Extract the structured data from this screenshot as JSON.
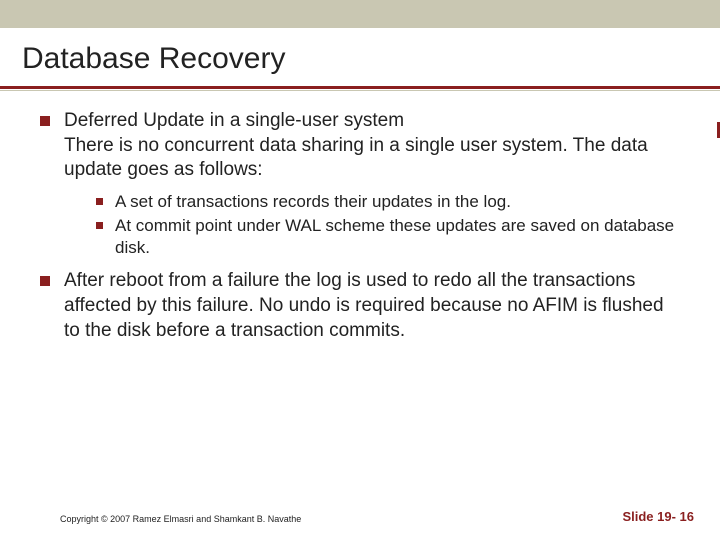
{
  "slide": {
    "title": "Database Recovery",
    "bullets_l1": [
      "Deferred Update in a single-user system\nThere is no concurrent data sharing in a single user system.  The data update goes as follows:",
      "After reboot from a failure the log is used to redo all the transactions affected by this failure.  No undo is required because no AFIM is flushed to the disk before a transaction commits."
    ],
    "bullets_l2": [
      "A set of transactions records their updates in the log.",
      "At commit point under WAL scheme these updates are saved on database disk."
    ],
    "copyright": "Copyright © 2007 Ramez Elmasri and Shamkant B. Navathe",
    "slide_number": "Slide 19- 16"
  }
}
